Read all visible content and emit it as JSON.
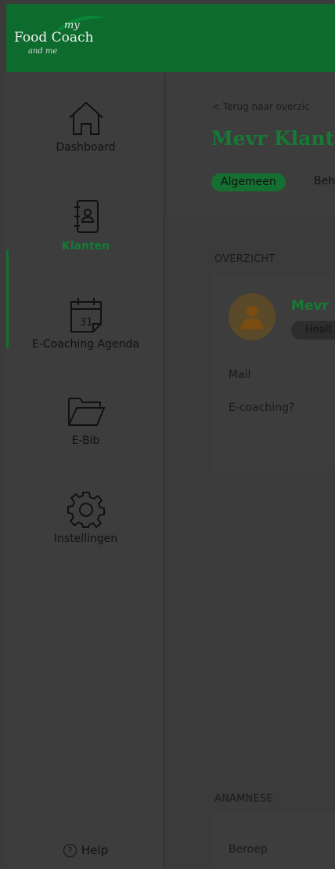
{
  "brand": {
    "logo_top": "my",
    "logo_main": "Food Coach",
    "logo_bottom": "and me",
    "color": "#0e6b2e"
  },
  "sidebar": {
    "items": [
      {
        "label": "Dashboard",
        "icon": "home-icon",
        "active": false
      },
      {
        "label": "Klanten",
        "icon": "contacts-book-icon",
        "active": true
      },
      {
        "label": "E-Coaching Agenda",
        "icon": "calendar-icon",
        "active": false
      },
      {
        "label": "E-Bib",
        "icon": "folder-icon",
        "active": false
      },
      {
        "label": "Instellingen",
        "icon": "gear-icon",
        "active": false
      }
    ],
    "help_label": "Help"
  },
  "main": {
    "back_link": "Terug naar overzic",
    "title": "Mevr Klant",
    "tabs": [
      {
        "label": "Algemeen",
        "active": true
      },
      {
        "label": "Beh",
        "active": false
      }
    ],
    "overview": {
      "section_title": "OVERZICHT",
      "client_name": "Mevr",
      "badge": "Healt",
      "fields": [
        {
          "label": "Mail"
        },
        {
          "label": "E-coaching?"
        }
      ]
    },
    "anamnese": {
      "section_title": "ANAMNESE",
      "fields": [
        {
          "label": "Beroep"
        }
      ]
    }
  },
  "colors": {
    "accent": "#157a34",
    "overlay_background": "#3b3b3b"
  }
}
